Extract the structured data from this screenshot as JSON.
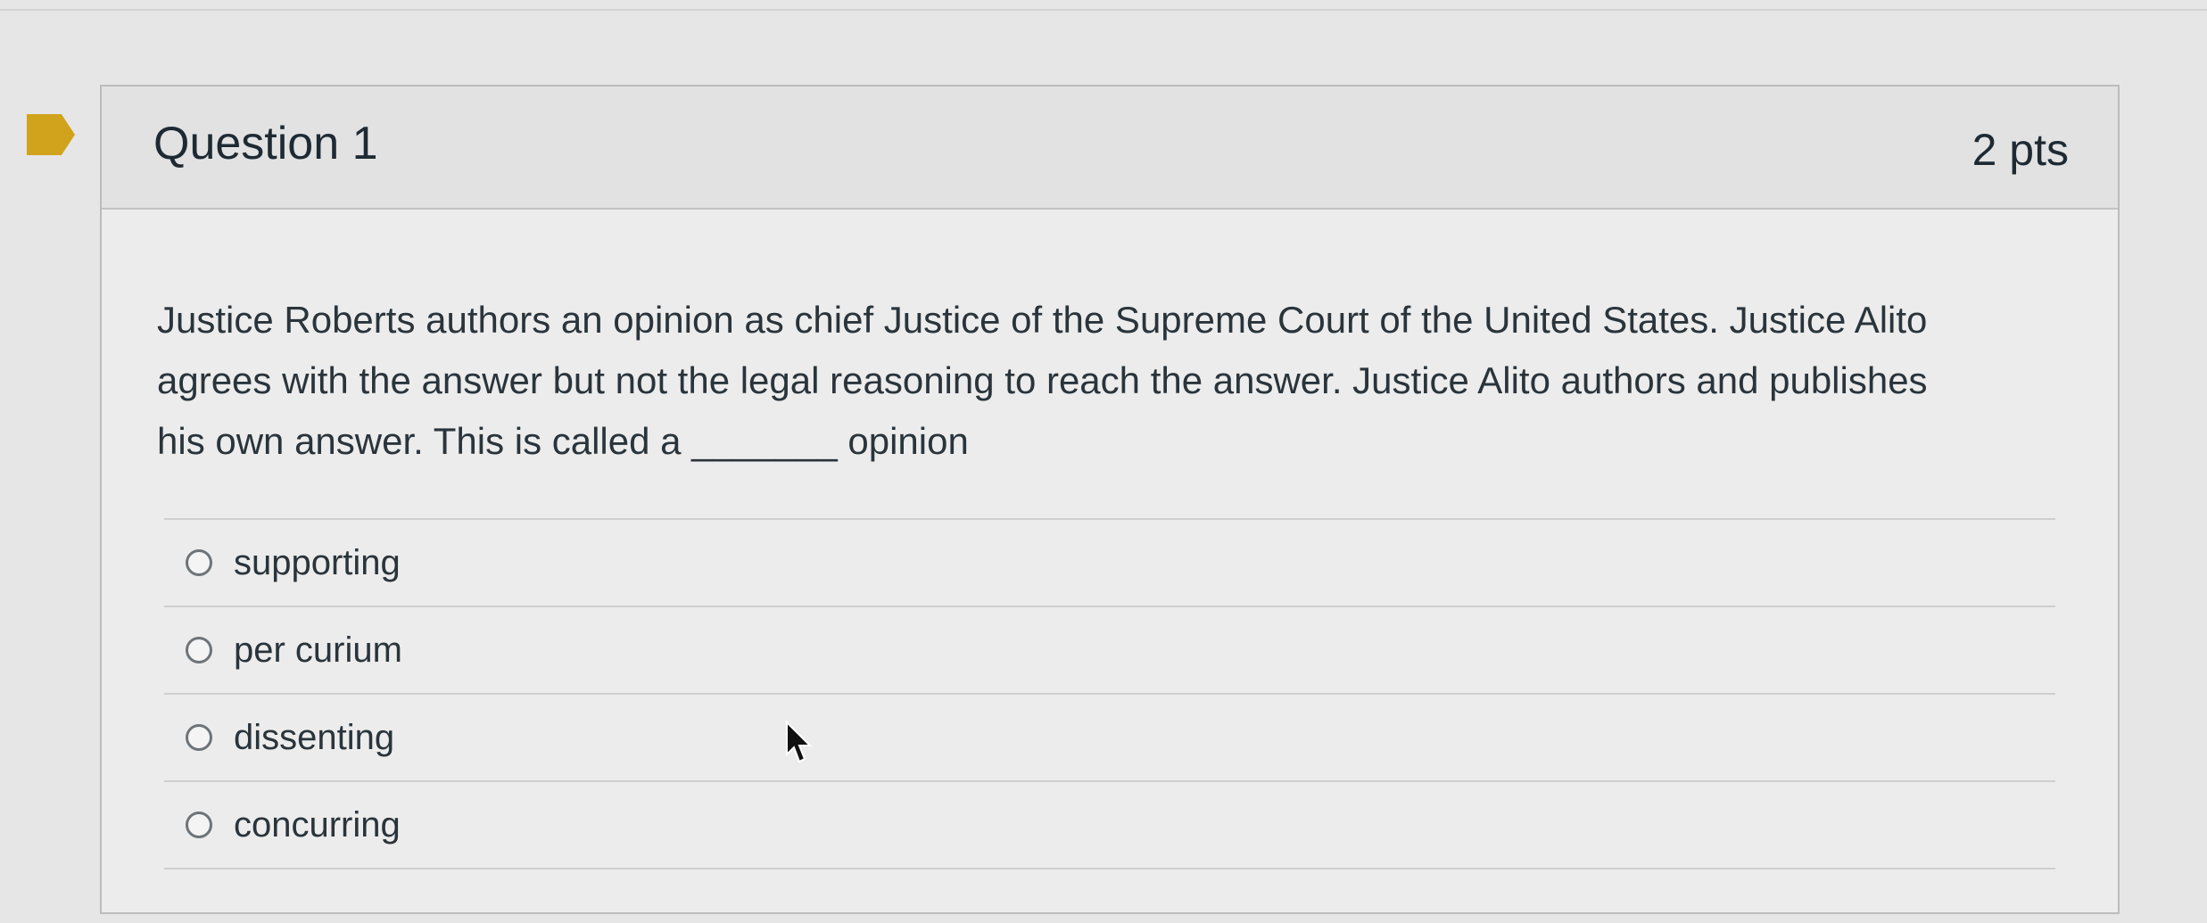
{
  "question": {
    "title": "Question 1",
    "points": "2 pts",
    "text_lines": [
      "Justice Roberts authors an opinion as chief Justice of the Supreme Court of the United States.  Justice Alito",
      "agrees with the answer but not the legal reasoning to reach the answer.  Justice Alito authors and publishes",
      "his own answer.  This is called a _______ opinion"
    ],
    "answers": [
      {
        "label": "supporting"
      },
      {
        "label": "per curium"
      },
      {
        "label": "dissenting"
      },
      {
        "label": "concurring"
      }
    ]
  },
  "colors": {
    "bookmark": "#d1a21c",
    "background": "#e6e6e6",
    "header": "#e2e2e2"
  },
  "icons": {
    "flag": "bookmark-flag-icon",
    "cursor": "mouse-pointer-icon",
    "radio": "radio-unchecked-icon"
  }
}
